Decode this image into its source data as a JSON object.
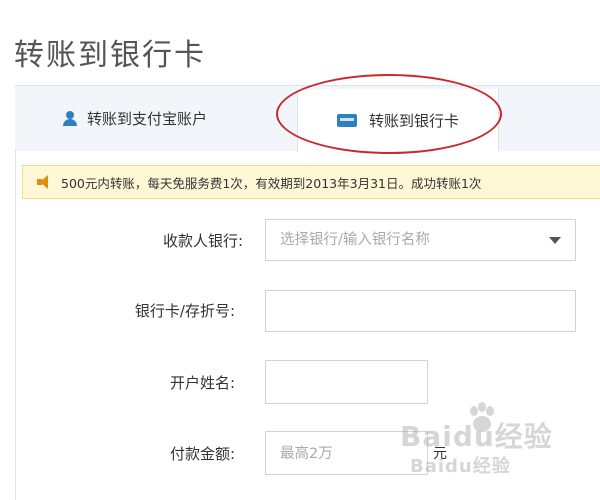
{
  "page": {
    "title": "转账到银行卡"
  },
  "tabs": [
    {
      "label": "转账到支付宝账户",
      "icon": "person-icon"
    },
    {
      "label": "转账到银行卡",
      "icon": "bank-card-icon"
    }
  ],
  "notice": {
    "text": "500元内转账，每天免服务费1次，有效期到2013年3月31日。成功转账1次",
    "icon": "speaker-icon"
  },
  "form": {
    "bank": {
      "label": "收款人银行:",
      "placeholder": "选择银行/输入银行名称"
    },
    "card": {
      "label": "银行卡/存折号:",
      "value": ""
    },
    "name": {
      "label": "开户姓名:",
      "value": ""
    },
    "amount": {
      "label": "付款金额:",
      "placeholder": "最高2万",
      "unit": "元"
    }
  },
  "watermark": {
    "text": "Baidu经验"
  },
  "colors": {
    "accent": "#2f7fc1",
    "highlight": "#c8282c",
    "notice_bg": "#fff7d6",
    "notice_icon": "#e08e12"
  }
}
